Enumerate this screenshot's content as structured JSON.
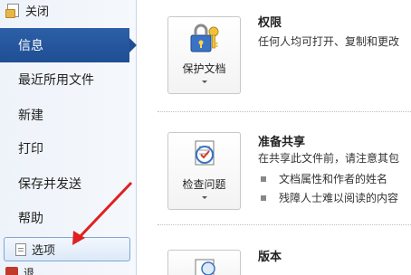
{
  "sidebar": {
    "close_label": "关闭",
    "items": [
      {
        "label": "信息",
        "active": true
      },
      {
        "label": "最近所用文件"
      },
      {
        "label": "新建"
      },
      {
        "label": "打印"
      },
      {
        "label": "保存并发送"
      },
      {
        "label": "帮助"
      }
    ],
    "options_label": "选项",
    "exit_label": "退"
  },
  "main": {
    "permissions": {
      "tile_label": "保护文档",
      "title": "权限",
      "description": "任何人均可打开、复制和更改"
    },
    "prepare": {
      "tile_label": "检查问题",
      "title": "准备共享",
      "description": "在共享此文件前，请注意其包",
      "bullets": [
        "文档属性和作者的姓名",
        "残障人士难以阅读的内容"
      ]
    },
    "versions": {
      "title": "版本"
    }
  },
  "colors": {
    "active_nav": "#1f4e93",
    "annotation_arrow": "#e02020"
  }
}
